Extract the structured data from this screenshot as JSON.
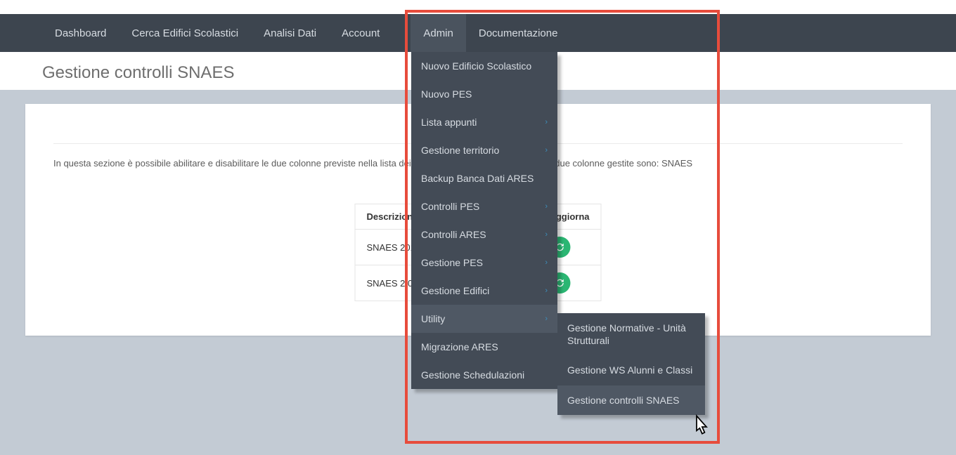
{
  "nav": {
    "items": [
      "Dashboard",
      "Cerca Edifici Scolastici",
      "Analisi Dati",
      "Account",
      "Admin",
      "Documentazione"
    ],
    "active_index": 4
  },
  "page": {
    "title": "Gestione controlli SNAES",
    "description": "In questa sezione è possibile abilitare e disabilitare le due colonne previste nella lista dei controlli SNAES. Nello specifico le due colonne gestite sono: SNAES"
  },
  "table": {
    "headers": {
      "descrizione": "Descrizione",
      "aggiorna": "Aggiorna"
    },
    "rows": [
      {
        "descrizione": "SNAES 2014"
      },
      {
        "descrizione": "SNAES 2.0 FASE"
      }
    ]
  },
  "dropdown": {
    "items": [
      {
        "label": "Nuovo Edificio Scolastico",
        "has_sub": false
      },
      {
        "label": "Nuovo PES",
        "has_sub": false
      },
      {
        "label": "Lista appunti",
        "has_sub": true
      },
      {
        "label": "Gestione territorio",
        "has_sub": true
      },
      {
        "label": "Backup Banca Dati ARES",
        "has_sub": false
      },
      {
        "label": "Controlli PES",
        "has_sub": true
      },
      {
        "label": "Controlli ARES",
        "has_sub": true
      },
      {
        "label": "Gestione PES",
        "has_sub": true
      },
      {
        "label": "Gestione Edifici",
        "has_sub": true
      },
      {
        "label": "Utility",
        "has_sub": true,
        "hover": true
      },
      {
        "label": "Migrazione ARES",
        "has_sub": false
      },
      {
        "label": "Gestione Schedulazioni",
        "has_sub": false
      }
    ]
  },
  "sub_dropdown": {
    "items": [
      {
        "label": "Gestione Normative - Unità Strutturali"
      },
      {
        "label": "Gestione WS Alunni e Classi"
      },
      {
        "label": "Gestione controlli SNAES",
        "hover": true
      }
    ]
  }
}
